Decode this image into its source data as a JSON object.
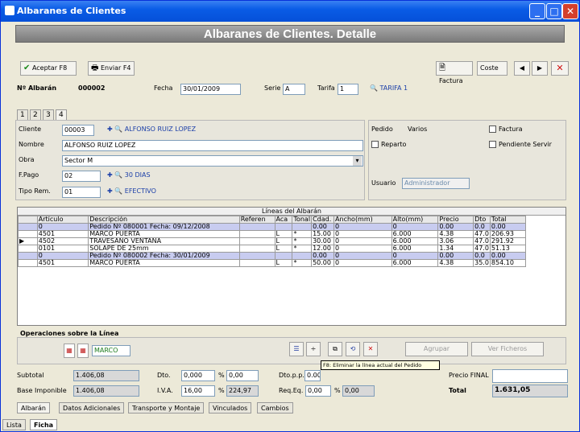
{
  "window": {
    "title": "Albaranes de Clientes"
  },
  "header": "Albaranes de Clientes. Detalle",
  "toolbar": {
    "aceptar": "Aceptar",
    "aceptar_key": "F8",
    "enviar": "Enviar",
    "enviar_key": "F4",
    "factura": "Factura",
    "coste": "Coste"
  },
  "doc": {
    "num_label": "Nº Albarán",
    "num": "000002",
    "fecha_label": "Fecha",
    "fecha": "30/01/2009",
    "serie_label": "Serie",
    "serie": "A",
    "tarifa_label": "Tarifa",
    "tarifa": "1",
    "tarifa_name": "TARIFA 1"
  },
  "tabs": [
    "1",
    "2",
    "3",
    "4"
  ],
  "client": {
    "cliente_label": "Cliente",
    "cliente_code": "00003",
    "cliente_name": "ALFONSO RUIZ LOPEZ",
    "nombre_label": "Nombre",
    "nombre": "ALFONSO RUIZ LOPEZ",
    "obra_label": "Obra",
    "obra": "Sector M",
    "fpago_label": "F.Pago",
    "fpago": "02",
    "fpago_name": "30 DIAS",
    "tiporem_label": "Tipo Rem.",
    "tiporem": "01",
    "tiporem_name": "EFECTIVO"
  },
  "right": {
    "pedido_label": "Pedido",
    "pedido": "Varios",
    "factura": "Factura",
    "reparto": "Reparto",
    "pendiente": "Pendiente Servir",
    "usuario_label": "Usuario",
    "usuario": "Administrador"
  },
  "grid": {
    "caption": "Líneas del Albarán",
    "headers": [
      "Artículo",
      "Descripción",
      "Referen",
      "Aca",
      "Tonal",
      "Cdad.",
      "Ancho(mm)",
      "Alto(mm)",
      "Precio",
      "Dto",
      "Total"
    ],
    "rows": [
      {
        "c": [
          "0",
          "Pedido Nº 080001 Fecha: 09/12/2008",
          "",
          "",
          "",
          "0.00",
          "0",
          "0",
          "0.00",
          "0.0",
          "0.00"
        ],
        "hl": true
      },
      {
        "c": [
          "4501",
          "MARCO PUERTA",
          "",
          "L",
          "*",
          "15.00",
          "0",
          "6.000",
          "4.38",
          "47.0",
          "206.93"
        ],
        "hl": false
      },
      {
        "c": [
          "4502",
          "TRAVESAÑO VENTANA",
          "",
          "L",
          "*",
          "30.00",
          "0",
          "6.000",
          "3.06",
          "47.0",
          "291.92"
        ],
        "hl": false
      },
      {
        "c": [
          "0101",
          "SOLAPE DE 25mm",
          "",
          "L",
          "*",
          "12.00",
          "0",
          "6.000",
          "1.34",
          "47.0",
          "51.13"
        ],
        "hl": false
      },
      {
        "c": [
          "0",
          "Pedido Nº 080002 Fecha: 30/01/2009",
          "",
          "",
          "",
          "0.00",
          "0",
          "0",
          "0.00",
          "0.0",
          "0.00"
        ],
        "hl": true
      },
      {
        "c": [
          "4501",
          "MARCO PUERTA",
          "",
          "L",
          "*",
          "50.00",
          "0",
          "6.000",
          "4.38",
          "35.0",
          "854.10"
        ],
        "hl": false
      }
    ]
  },
  "ops": {
    "title": "Operaciones sobre la Línea",
    "marco": "MARCO",
    "agrupar": "Agrupar",
    "ver_ficheros": "Ver Ficheros",
    "tooltip": "F8: Eliminar la línea actual del Pedido"
  },
  "totals": {
    "subtotal_label": "Subtotal",
    "subtotal": "1.406,08",
    "dto_label": "Dto.",
    "dto_pct": "0,000",
    "dto_val": "0,00",
    "dtopp_label": "Dto.p.p.",
    "dtopp": "0.000",
    "dtopp_val": "0,00",
    "base_label": "Base Imponible",
    "base": "1.406,08",
    "iva_label": "I.V.A.",
    "iva_pct": "16,00",
    "iva_val": "224,97",
    "req_label": "Req.Eq.",
    "req_pct": "0,00",
    "req_val": "0,00",
    "total_label": "Total",
    "total": "1.631,05",
    "precio_final_label": "Precio FINAL",
    "precio_final": ""
  },
  "bottom_tabs": [
    "Albarán",
    "Datos Adicionales",
    "Transporte y Montaje",
    "Vinculados",
    "Cambios"
  ],
  "view_tabs": [
    "Lista",
    "Ficha"
  ]
}
